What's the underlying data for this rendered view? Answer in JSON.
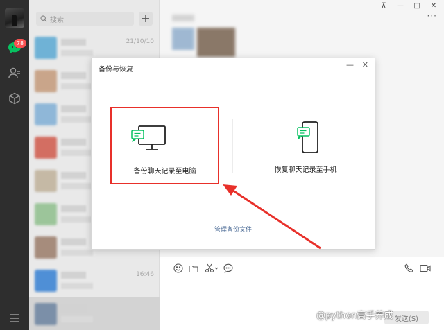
{
  "nav": {
    "badge_count": "78"
  },
  "chat_list": {
    "search_placeholder": "搜索",
    "add_label": "+",
    "rows": [
      {
        "time": "21/10/10",
        "color": "#6fb2d6"
      },
      {
        "time": "",
        "color": "#c9a58a"
      },
      {
        "time": "",
        "color": "#8fb7d8"
      },
      {
        "time": "",
        "color": "#d36e62"
      },
      {
        "time": "",
        "color": "#c5b9a5"
      },
      {
        "time": "",
        "color": "#9cc59a"
      },
      {
        "time": "",
        "color": "#a68c7c"
      },
      {
        "time": "16:46",
        "color": "#4f8fd6"
      },
      {
        "time": "",
        "color": "#7b8fa8"
      }
    ]
  },
  "window_controls": {
    "pin": "⊼",
    "minimize": "—",
    "maximize": "□",
    "close": "✕"
  },
  "main": {
    "more": "···",
    "send_label": "发送(S)"
  },
  "dialog": {
    "title": "备份与恢复",
    "minimize": "—",
    "close": "✕",
    "backup_to_pc": "备份聊天记录至电脑",
    "restore_to_phone": "恢复聊天记录至手机",
    "manage_backup": "管理备份文件"
  },
  "accent": {
    "wechat_green": "#07c160",
    "highlight_red": "#e8302a"
  },
  "watermark": "@python高手养成"
}
